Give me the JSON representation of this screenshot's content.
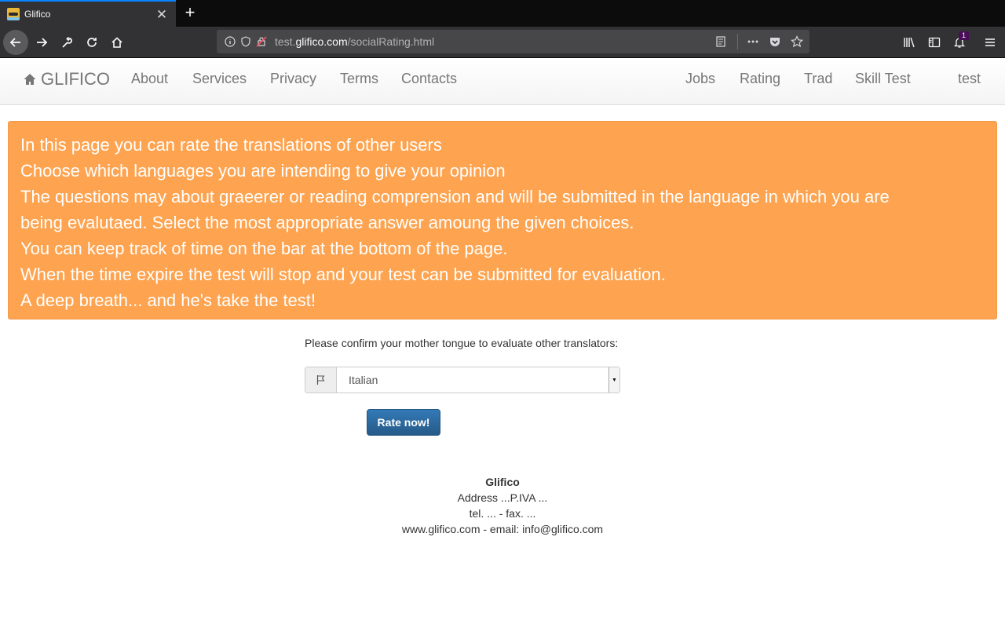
{
  "browser": {
    "tab_title": "Glifico",
    "tab_close": "✕",
    "new_tab": "+",
    "url_host_prefix": "test.",
    "url_domain": "glifico.com",
    "url_path": "/socialRating.html",
    "notification_count": "1"
  },
  "site_nav": {
    "brand": "GLIFICO",
    "left_links": [
      "About",
      "Services",
      "Privacy",
      "Terms",
      "Contacts"
    ],
    "right_links": [
      "Jobs",
      "Rating",
      "Trad",
      "Skill Test",
      "test"
    ]
  },
  "alert": {
    "color": "#fea34f",
    "lines": [
      "In this page you can rate the translations of other users",
      "Choose which languages you are intending to give your opinion",
      "The questions may about graeerer or reading comprension and will be submitted in the language in which you are",
      "being evalutaed. Select the most appropriate answer amoung the given choices.",
      "You can keep track of time on the bar at the bottom of the page.",
      "When the time expire the test will stop and your test can be submitted for evaluation.",
      "A deep breath... and he's take the test!"
    ]
  },
  "form": {
    "label": "Please confirm your mother tongue to evaluate other translators:",
    "selected_language": "Italian",
    "submit_label": "Rate now!"
  },
  "footer": {
    "name": "Glifico",
    "address": "Address ...P.IVA ...",
    "phone": "tel. ... - fax. ...",
    "web": "www.glifico.com - email: info@glifico.com"
  }
}
